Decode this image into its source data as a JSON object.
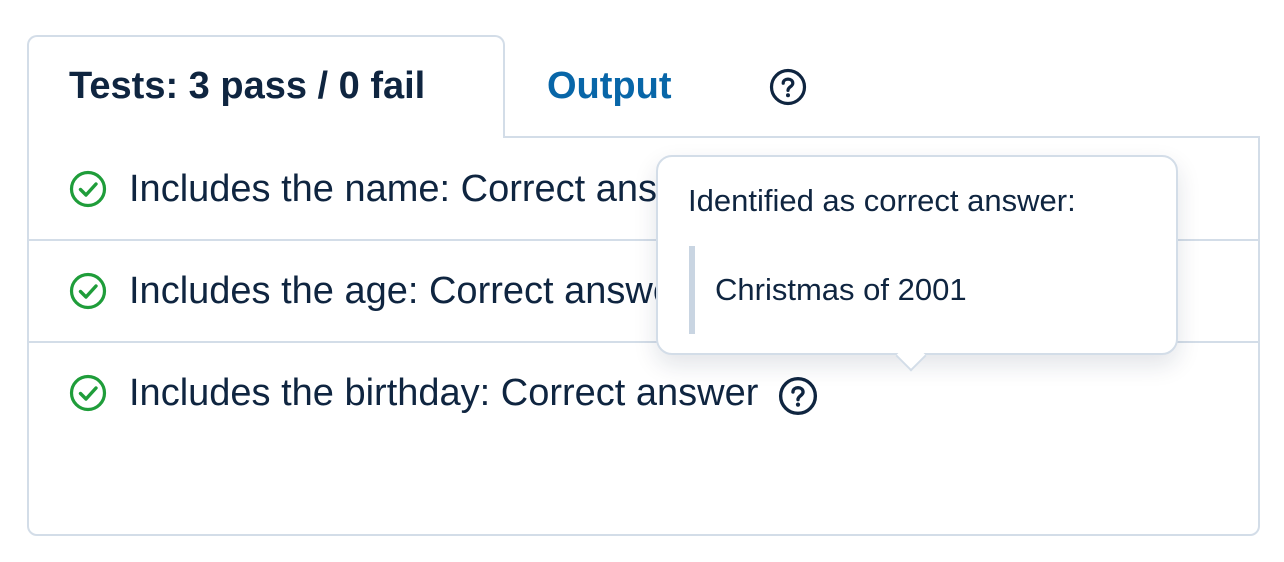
{
  "tabs": {
    "tests_label": "Tests: 3 pass / 0 fail",
    "output_label": "Output"
  },
  "tests": [
    {
      "text": "Includes the name: Correct answer",
      "status": "pass"
    },
    {
      "text": "Includes the age: Correct answer",
      "status": "pass"
    },
    {
      "text": "Includes the birthday: Correct answer",
      "status": "pass"
    }
  ],
  "tooltip": {
    "heading": "Identified as correct answer:",
    "answer": "Christmas of 2001"
  },
  "icons": {
    "pass": "check-circle-icon",
    "help": "question-circle-icon"
  },
  "colors": {
    "pass_green": "#1f9d3a",
    "link_blue": "#0866a8",
    "text_dark": "#0f2540",
    "border": "#d3dde8"
  }
}
